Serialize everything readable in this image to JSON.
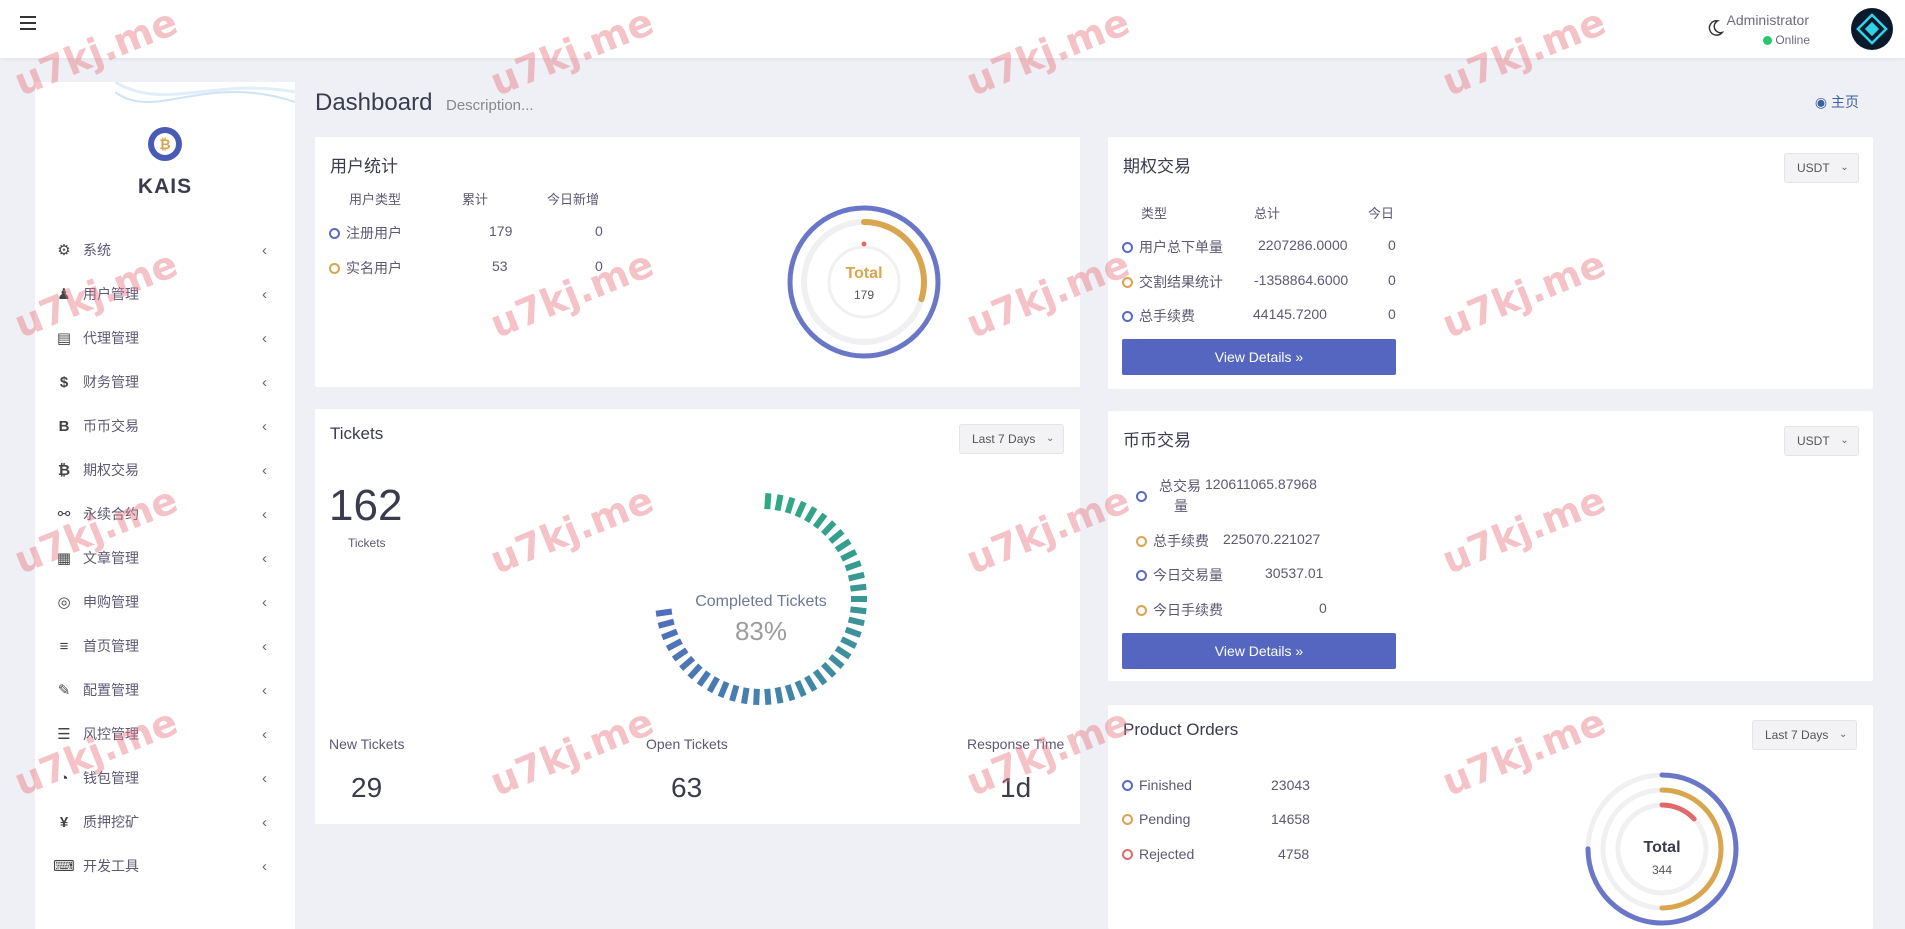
{
  "topbar": {
    "user_name": "Administrator",
    "user_status": "Online"
  },
  "sidebar": {
    "brand": "KAIS",
    "items": [
      {
        "label": "系统",
        "icon": "gear-icon",
        "glyph": "⚙"
      },
      {
        "label": "用户管理",
        "icon": "user-icon",
        "glyph": "♟"
      },
      {
        "label": "代理管理",
        "icon": "id-card-icon",
        "glyph": "▤"
      },
      {
        "label": "财务管理",
        "icon": "dollar-icon",
        "glyph": "$"
      },
      {
        "label": "币币交易",
        "icon": "bitcoin-b-icon",
        "glyph": "B"
      },
      {
        "label": "期权交易",
        "icon": "bitcoin-icon",
        "glyph": "₿"
      },
      {
        "label": "永续合约",
        "icon": "link-icon",
        "glyph": "⚯"
      },
      {
        "label": "文章管理",
        "icon": "newspaper-icon",
        "glyph": "▦"
      },
      {
        "label": "申购管理",
        "icon": "lifebuoy-icon",
        "glyph": "◎"
      },
      {
        "label": "首页管理",
        "icon": "list-icon",
        "glyph": "≡"
      },
      {
        "label": "配置管理",
        "icon": "wrench-icon",
        "glyph": "✎"
      },
      {
        "label": "风控管理",
        "icon": "list-bullets-icon",
        "glyph": "☰"
      },
      {
        "label": "钱包管理",
        "icon": "wallet-icon",
        "glyph": "◔"
      },
      {
        "label": "质押挖矿",
        "icon": "yen-icon",
        "glyph": "¥"
      },
      {
        "label": "开发工具",
        "icon": "keyboard-icon",
        "glyph": "⌨"
      }
    ]
  },
  "header": {
    "title": "Dashboard",
    "description": "Description...",
    "home": "主页"
  },
  "user_stats": {
    "title": "用户统计",
    "headers": [
      "用户类型",
      "累计",
      "今日新增"
    ],
    "rows": [
      {
        "label": "注册用户",
        "total": "179",
        "today": "0"
      },
      {
        "label": "实名用户",
        "total": "53",
        "today": "0"
      }
    ],
    "donut_label": "Total",
    "donut_value": "179",
    "ratio": 0.2961
  },
  "options": {
    "title": "期权交易",
    "currency": "USDT",
    "headers": [
      "类型",
      "总计",
      "今日"
    ],
    "rows": [
      {
        "label": "用户总下单量",
        "total": "2207286.0000",
        "today": "0"
      },
      {
        "label": "交割结果统计",
        "total": "-1358864.6000",
        "today": "0"
      },
      {
        "label": "总手续费",
        "total": "44145.7200",
        "today": "0"
      }
    ],
    "button": "View Details »"
  },
  "tickets": {
    "title": "Tickets",
    "range": "Last 7 Days",
    "count": "162",
    "count_label": "Tickets",
    "gauge_label": "Completed Tickets",
    "gauge_value": "83%",
    "percent": 83,
    "stats": [
      {
        "label": "New Tickets",
        "value": "29"
      },
      {
        "label": "Open Tickets",
        "value": "63"
      },
      {
        "label": "Response Time",
        "value": "1d"
      }
    ]
  },
  "spot": {
    "title": "币币交易",
    "currency": "USDT",
    "row1_label_a": "总交易",
    "row1_label_b": "量",
    "row1_value": "120611065.87968",
    "rows": [
      {
        "label": "总手续费",
        "value": "225070.221027"
      },
      {
        "label": "今日交易量",
        "value": "30537.01"
      },
      {
        "label": "今日手续费",
        "value": "0"
      }
    ],
    "button": "View Details »"
  },
  "orders": {
    "title": "Product Orders",
    "range": "Last 7 Days",
    "rows": [
      {
        "label": "Finished",
        "value": "23043"
      },
      {
        "label": "Pending",
        "value": "14658"
      },
      {
        "label": "Rejected",
        "value": "4758"
      }
    ],
    "donut_label": "Total",
    "donut_value": "344"
  },
  "watermark": "u7kj.me",
  "colors": {
    "accent": "#5566c1",
    "orange": "#d9a54e",
    "red": "#e06a6a",
    "success": "#28c76f"
  }
}
